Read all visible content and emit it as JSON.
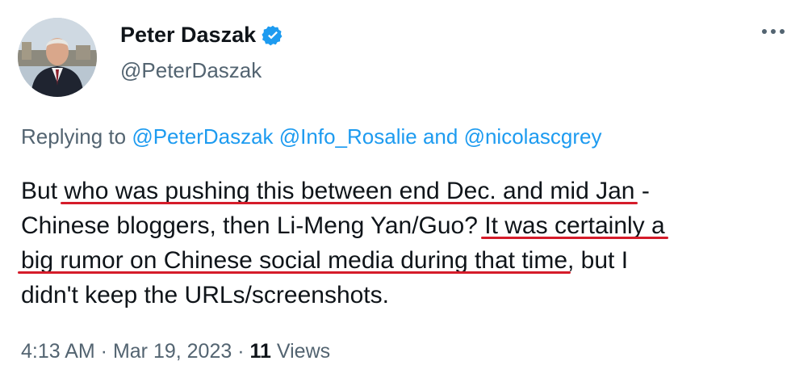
{
  "user": {
    "display_name": "Peter Daszak",
    "handle": "@PeterDaszak",
    "verified_icon": "verified-badge-icon",
    "verified_color": "#1d9bf0"
  },
  "reply": {
    "prefix": "Replying to",
    "mention1": "@PeterDaszak",
    "mention2": "@Info_Rosalie",
    "conj": "and",
    "mention3": "@nicolascgrey"
  },
  "body": {
    "l1_plain": "But ",
    "l1_ul": "who was pushing this between end Dec. and mid Jan",
    "l1_tail": " -",
    "l2_plain": "Chinese bloggers, then Li-Meng Yan/Guo?  ",
    "l2_ul": "It was certainly a",
    "l3_ul": "big rumor on Chinese social media during that time",
    "l3_tail": ", but I",
    "l4": "didn't keep the URLs/screenshots."
  },
  "meta": {
    "time": "4:13 AM",
    "sep1": " · ",
    "date": "Mar 19, 2023",
    "sep2": " · ",
    "views_count": "11",
    "views_label": " Views"
  },
  "colors": {
    "text": "#0f1419",
    "secondary": "#536471",
    "link": "#1d9bf0",
    "underline": "#d51c2a"
  },
  "icons": {
    "more": "more-horizontal-icon"
  }
}
